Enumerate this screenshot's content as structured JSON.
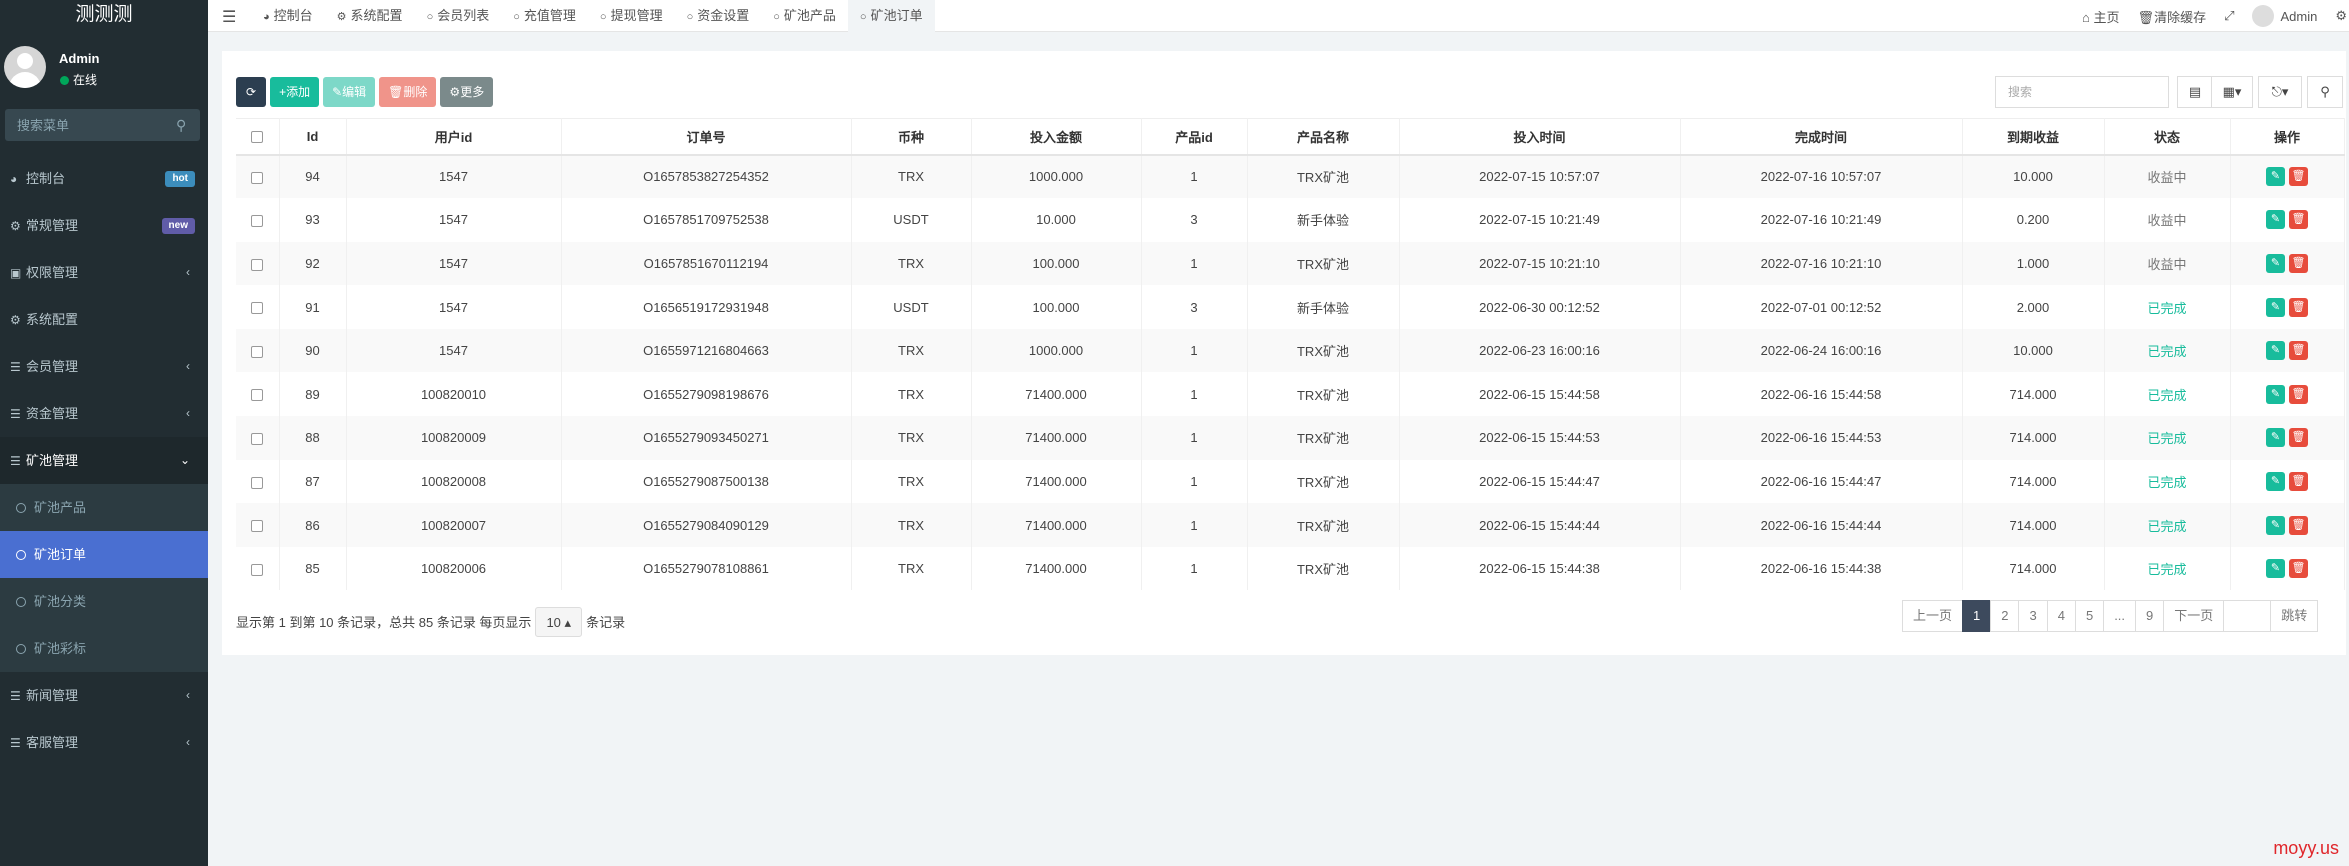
{
  "sidebar": {
    "logo": "测测测",
    "user": {
      "name": "Admin",
      "status": "在线"
    },
    "search_placeholder": "搜索菜单",
    "menu": [
      {
        "label": "控制台",
        "badge": "hot",
        "badge_color": "#3c8dbc"
      },
      {
        "label": "常规管理",
        "badge": "new",
        "badge_color": "#605ca8"
      },
      {
        "label": "权限管理"
      },
      {
        "label": "系统配置"
      },
      {
        "label": "会员管理"
      },
      {
        "label": "资金管理"
      },
      {
        "label": "矿池管理"
      }
    ],
    "submenu": [
      {
        "label": "矿池产品"
      },
      {
        "label": "矿池订单"
      },
      {
        "label": "矿池分类"
      },
      {
        "label": "矿池彩标"
      }
    ],
    "menu_after": [
      {
        "label": "新闻管理"
      },
      {
        "label": "客服管理"
      }
    ]
  },
  "topbar": {
    "tabs": [
      "控制台",
      "系统配置",
      "会员列表",
      "充值管理",
      "提现管理",
      "资金设置",
      "矿池产品",
      "矿池订单"
    ],
    "right": {
      "home": "主页",
      "clear_cache": "清除缓存",
      "user": "Admin"
    }
  },
  "toolbar": {
    "refresh_label": "",
    "add_label": "添加",
    "edit_label": "编辑",
    "delete_label": "删除",
    "more_label": "更多",
    "search_placeholder": "搜索"
  },
  "table": {
    "headers": [
      "Id",
      "用户id",
      "订单号",
      "币种",
      "投入金额",
      "产品id",
      "产品名称",
      "投入时间",
      "完成时间",
      "到期收益",
      "状态",
      "操作"
    ],
    "rows": [
      [
        "94",
        "1547",
        "O1657853827254352",
        "TRX",
        "1000.000",
        "1",
        "TRX矿池",
        "2022-07-15 10:57:07",
        "2022-07-16 10:57:07",
        "10.000",
        "收益中"
      ],
      [
        "93",
        "1547",
        "O1657851709752538",
        "USDT",
        "10.000",
        "3",
        "新手体验",
        "2022-07-15 10:21:49",
        "2022-07-16 10:21:49",
        "0.200",
        "收益中"
      ],
      [
        "92",
        "1547",
        "O1657851670112194",
        "TRX",
        "100.000",
        "1",
        "TRX矿池",
        "2022-07-15 10:21:10",
        "2022-07-16 10:21:10",
        "1.000",
        "收益中"
      ],
      [
        "91",
        "1547",
        "O1656519172931948",
        "USDT",
        "100.000",
        "3",
        "新手体验",
        "2022-06-30 00:12:52",
        "2022-07-01 00:12:52",
        "2.000",
        "已完成"
      ],
      [
        "90",
        "1547",
        "O1655971216804663",
        "TRX",
        "1000.000",
        "1",
        "TRX矿池",
        "2022-06-23 16:00:16",
        "2022-06-24 16:00:16",
        "10.000",
        "已完成"
      ],
      [
        "89",
        "100820010",
        "O1655279098198676",
        "TRX",
        "71400.000",
        "1",
        "TRX矿池",
        "2022-06-15 15:44:58",
        "2022-06-16 15:44:58",
        "714.000",
        "已完成"
      ],
      [
        "88",
        "100820009",
        "O1655279093450271",
        "TRX",
        "71400.000",
        "1",
        "TRX矿池",
        "2022-06-15 15:44:53",
        "2022-06-16 15:44:53",
        "714.000",
        "已完成"
      ],
      [
        "87",
        "100820008",
        "O1655279087500138",
        "TRX",
        "71400.000",
        "1",
        "TRX矿池",
        "2022-06-15 15:44:47",
        "2022-06-16 15:44:47",
        "714.000",
        "已完成"
      ],
      [
        "86",
        "100820007",
        "O1655279084090129",
        "TRX",
        "71400.000",
        "1",
        "TRX矿池",
        "2022-06-15 15:44:44",
        "2022-06-16 15:44:44",
        "714.000",
        "已完成"
      ],
      [
        "85",
        "100820006",
        "O1655279078108861",
        "TRX",
        "71400.000",
        "1",
        "TRX矿池",
        "2022-06-15 15:44:38",
        "2022-06-16 15:44:38",
        "714.000",
        "已完成"
      ]
    ]
  },
  "footer": {
    "summary": "显示第 1 到第 10 条记录，总共 85 条记录 每页显示",
    "page_size": "10",
    "suffix": "条记录"
  },
  "pagination": {
    "prev": "上一页",
    "pages": [
      "1",
      "2",
      "3",
      "4",
      "5",
      "...",
      "9"
    ],
    "next": "下一页",
    "jump": "跳转"
  },
  "watermark": "moyy.us",
  "colors": {
    "sidebar_bg": "#222d32",
    "active_menu": "#4a6fd1",
    "success": "#18bc9c",
    "danger": "#e74c3c",
    "status_done": "#18bc9c",
    "status_running": "#777777"
  }
}
